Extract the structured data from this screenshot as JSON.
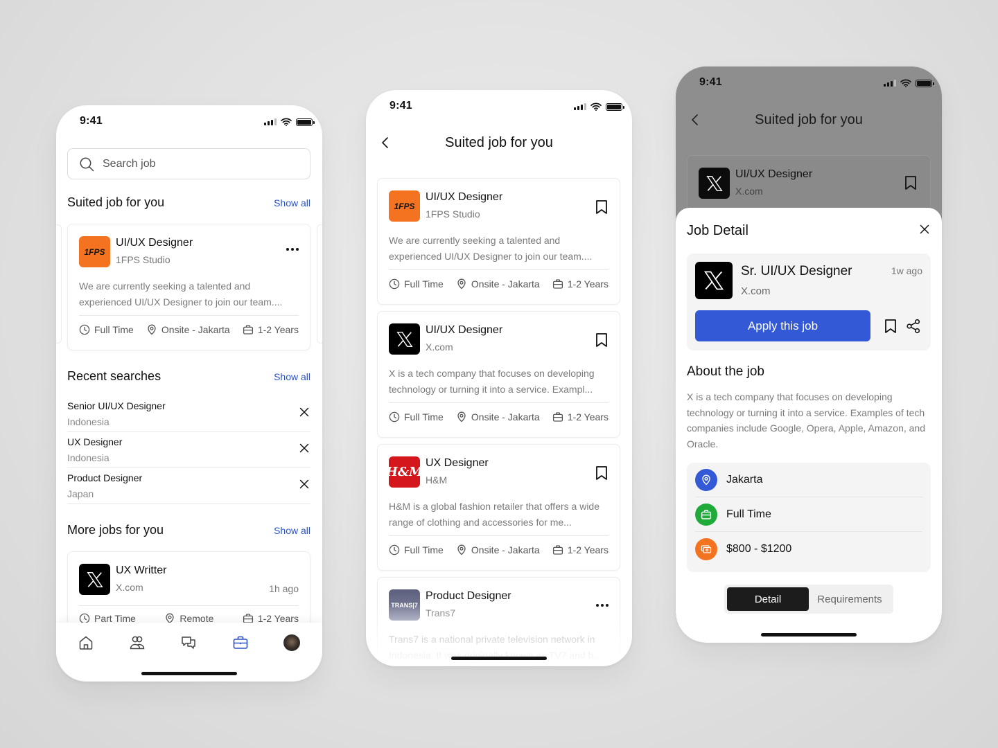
{
  "status_time": "9:41",
  "colors": {
    "accent": "#2a52c9",
    "apply_button": "#3459d6",
    "location_icon_bg": "#3459d6",
    "jobtype_icon_bg": "#1faa3a",
    "salary_icon_bg": "#f47320",
    "logo_1fps": "#f47320",
    "logo_hm": "#d3171c"
  },
  "home": {
    "search": {
      "placeholder": "Search job"
    },
    "suited": {
      "heading": "Suited job for you",
      "show_all": "Show all",
      "card": {
        "logo": "1FPS",
        "title": "UI/UX Designer",
        "company": "1FPS Studio",
        "description": "We are currently seeking a talented and experienced UI/UX Designer to join our team....",
        "meta": {
          "type": "Full Time",
          "location": "Onsite - Jakarta",
          "experience": "1-2 Years"
        }
      }
    },
    "recent": {
      "heading": "Recent searches",
      "show_all": "Show all",
      "items": [
        {
          "title": "Senior UI/UX Designer",
          "location": "Indonesia"
        },
        {
          "title": "UX Designer",
          "location": "Indonesia"
        },
        {
          "title": "Product Designer",
          "location": "Japan"
        }
      ]
    },
    "more": {
      "heading": "More jobs for you",
      "show_all": "Show all",
      "card": {
        "title": "UX Writter",
        "company": "X.com",
        "posted": "1h ago",
        "meta": {
          "type": "Part Time",
          "location": "Remote",
          "experience": "1-2 Years"
        }
      }
    },
    "tabbar": [
      "home-icon",
      "people-icon",
      "chat-icon",
      "briefcase-icon",
      "profile-avatar"
    ],
    "active_tab": "briefcase-icon"
  },
  "list": {
    "title": "Suited job for you",
    "jobs": [
      {
        "logo": "1FPS",
        "title": "UI/UX Designer",
        "company": "1FPS Studio",
        "description": "We are currently seeking a talented and experienced UI/UX Designer to join our team....",
        "meta": {
          "type": "Full Time",
          "location": "Onsite - Jakarta",
          "experience": "1-2 Years"
        }
      },
      {
        "logo": "X",
        "title": "UI/UX Designer",
        "company": "X.com",
        "description": "X is a tech company that focuses on developing technology or turning it into a service. Exampl...",
        "meta": {
          "type": "Full Time",
          "location": "Onsite - Jakarta",
          "experience": "1-2 Years"
        }
      },
      {
        "logo": "H&M",
        "title": "UX Designer",
        "company": "H&M",
        "description": "H&M is a global fashion retailer that offers a wide range of clothing and accessories for me...",
        "meta": {
          "type": "Full Time",
          "location": "Onsite - Jakarta",
          "experience": "1-2 Years"
        }
      },
      {
        "logo": "TRANS|7",
        "title": "Product Designer",
        "company": "Trans7",
        "description": "Trans7 is a national private television network in Indonesia. It was originally known as TV7 and b..."
      }
    ]
  },
  "detail": {
    "nav_title": "Suited job for you",
    "background_card": {
      "title": "UI/UX Designer",
      "company": "X.com"
    },
    "sheet_title": "Job Detail",
    "job": {
      "title": "Sr. UI/UX Designer",
      "company": "X.com",
      "posted": "1w ago"
    },
    "apply_label": "Apply this job",
    "about_heading": "About the job",
    "about_text": "X is a tech company that focuses on developing technology or turning it into a service. Examples of tech companies include Google, Opera, Apple, Amazon, and Oracle.",
    "info": [
      {
        "icon": "location-icon",
        "text": "Jakarta"
      },
      {
        "icon": "briefcase-icon",
        "text": "Full Time"
      },
      {
        "icon": "money-icon",
        "text": "$800 - $1200"
      }
    ],
    "tabs": [
      {
        "label": "Detail",
        "active": true
      },
      {
        "label": "Requirements",
        "active": false
      }
    ]
  }
}
